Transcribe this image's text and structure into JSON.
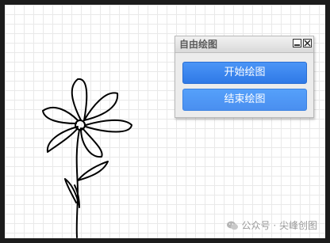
{
  "panel": {
    "title": "自由绘图",
    "start_label": "开始绘图",
    "end_label": "结束绘图"
  },
  "watermark": {
    "text": "公众号 · 尖峰创图"
  },
  "colors": {
    "accent": "#3a86ef",
    "frame": "#1c1c1c",
    "grid": "#e9e9e9"
  },
  "icons": {
    "minimize": "minimize-icon",
    "close": "close-icon",
    "watermark": "wechat-icon"
  }
}
